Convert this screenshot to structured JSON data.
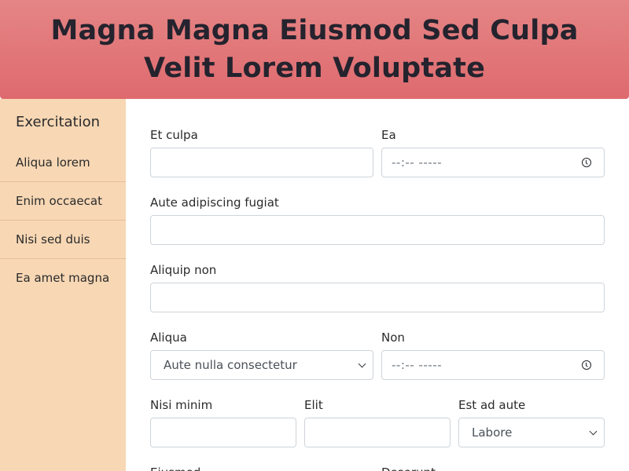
{
  "header": {
    "title": "Magna Magna Eiusmod Sed Culpa Velit Lorem Voluptate"
  },
  "sidebar": {
    "title": "Exercitation",
    "items": [
      {
        "label": "Aliqua lorem"
      },
      {
        "label": "Enim occaecat"
      },
      {
        "label": "Nisi sed duis"
      },
      {
        "label": "Ea amet magna"
      }
    ]
  },
  "form": {
    "et_culpa": {
      "label": "Et culpa",
      "value": ""
    },
    "ea": {
      "label": "Ea",
      "value": "--:-- -----",
      "icon": "clock-icon"
    },
    "aute_adipiscing": {
      "label": "Aute adipiscing fugiat",
      "value": ""
    },
    "aliquip_non": {
      "label": "Aliquip non",
      "value": ""
    },
    "aliqua": {
      "label": "Aliqua",
      "value": "Aute nulla consectetur"
    },
    "non": {
      "label": "Non",
      "value": "--:-- -----",
      "icon": "clock-icon"
    },
    "nisi_minim": {
      "label": "Nisi minim",
      "value": ""
    },
    "elit": {
      "label": "Elit",
      "value": ""
    },
    "est_ad_aute": {
      "label": "Est ad aute",
      "value": "Labore"
    },
    "eiusmod": {
      "label": "Eiusmod"
    },
    "deserunt": {
      "label": "Deserunt"
    }
  },
  "colors": {
    "header_bg": "#e07476",
    "sidebar_bg": "#f7d7b4",
    "title_text": "#24232e"
  }
}
